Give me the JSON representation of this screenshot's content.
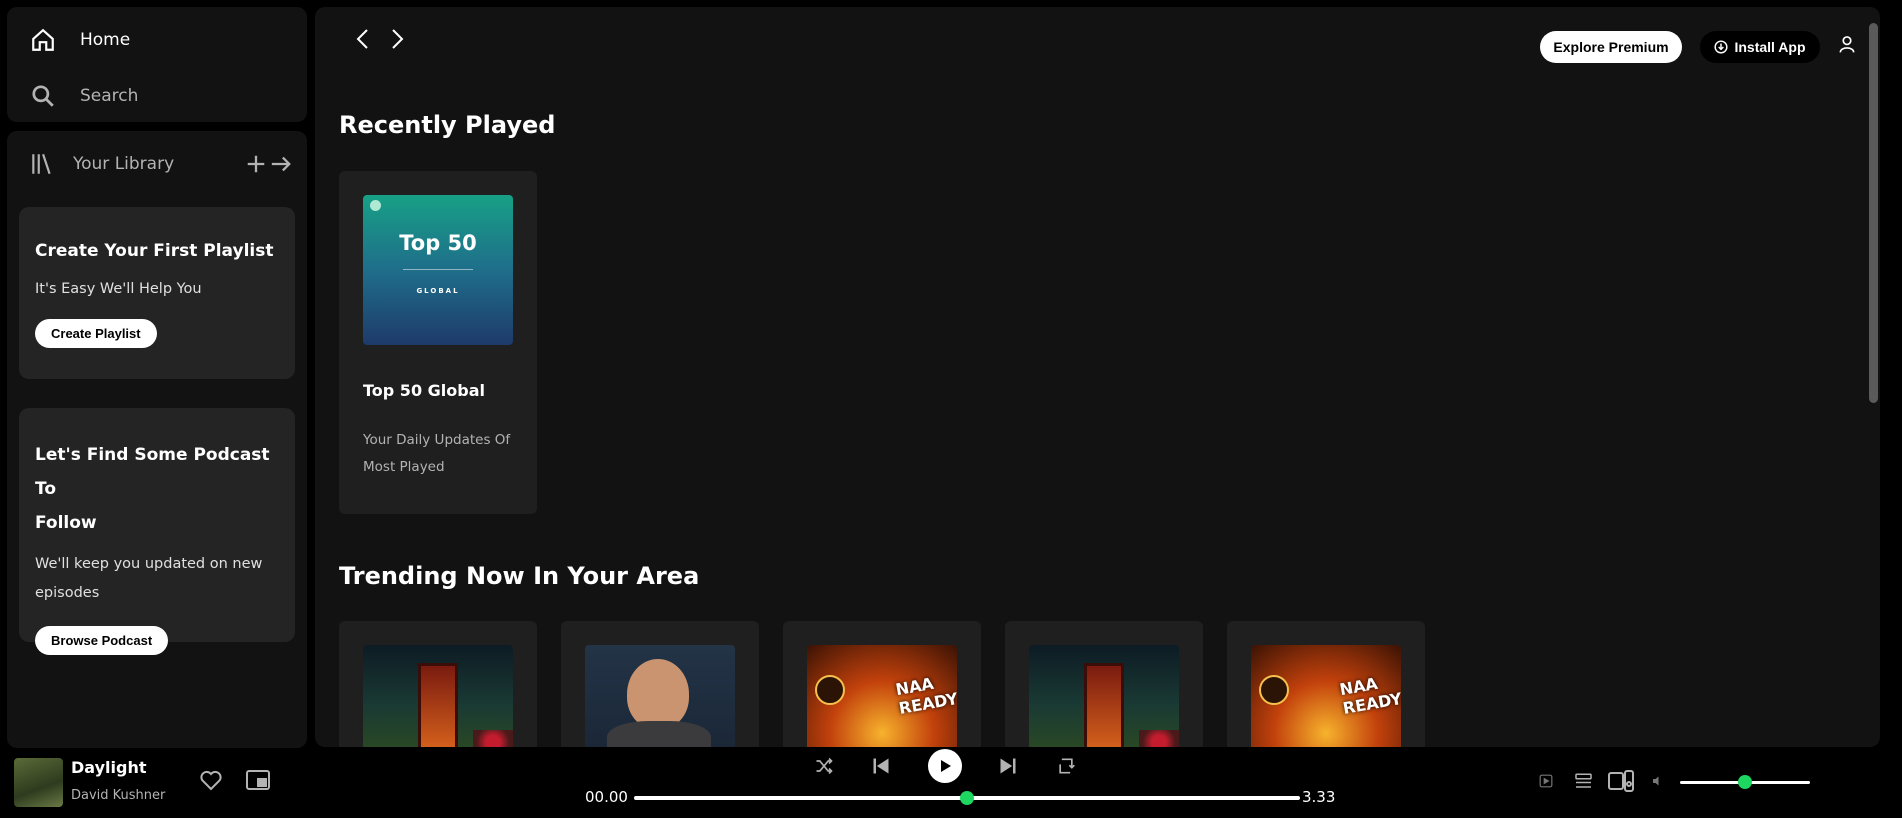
{
  "sidebar": {
    "home_label": "Home",
    "search_label": "Search",
    "library_label": "Your Library",
    "playlist_card": {
      "title": "Create Your First Playlist",
      "subtitle": "It's Easy We'll Help You",
      "button": "Create Playlist"
    },
    "podcast_card": {
      "title_line1": "Let's Find Some Podcast To",
      "title_line2": "Follow",
      "subtitle_line1": "We'll keep you updated on new",
      "subtitle_line2": "episodes",
      "button": "Browse Podcast"
    }
  },
  "header": {
    "explore_premium": "Explore Premium",
    "install_app": "Install App"
  },
  "recently_played": {
    "title": "Recently Played",
    "items": [
      {
        "title": "Top 50 Global",
        "desc_line1": "Your Daily Updates Of",
        "desc_line2": "Most Played",
        "art_title": "Top 50",
        "art_sub": "GLOBAL"
      }
    ]
  },
  "trending": {
    "title": "Trending Now In Your Area",
    "items": [
      {
        "art": "phone-booth"
      },
      {
        "art": "portrait"
      },
      {
        "art": "naa-ready",
        "art_text": "NAA READY"
      },
      {
        "art": "phone-booth"
      },
      {
        "art": "naa-ready",
        "art_text": "NAA READY"
      }
    ]
  },
  "player": {
    "song": "Daylight",
    "artist": "David Kushner",
    "current_time": "00.00",
    "total_time": "3.33",
    "progress_fraction": 0.5,
    "volume_fraction": 0.5
  },
  "colors": {
    "accent": "#1ed760",
    "panel": "#121212",
    "card": "#242424",
    "background": "#000000"
  }
}
